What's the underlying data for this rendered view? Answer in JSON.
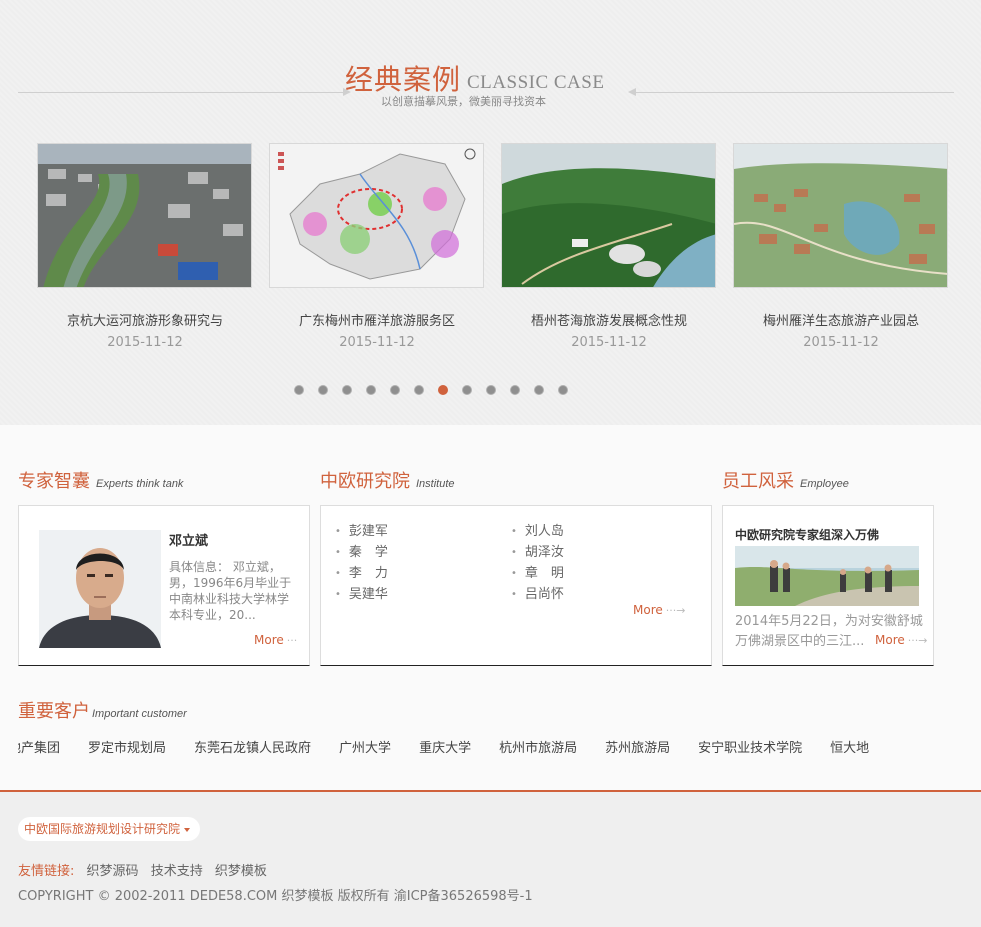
{
  "cases": {
    "title_cn": "经典案例",
    "title_en": "CLASSIC CASE",
    "subtitle": "以创意描摹风景，微美丽寻找资本",
    "items": [
      {
        "name": "京杭大运河旅游形象研究与",
        "date": "2015-11-12",
        "image": "city-canal-aerial"
      },
      {
        "name": "广东梅州市雁洋旅游服务区",
        "date": "2015-11-12",
        "image": "planning-map"
      },
      {
        "name": "梧州苍海旅游发展概念性规",
        "date": "2015-11-12",
        "image": "green-park-rendering"
      },
      {
        "name": "梅州雁洋生态旅游产业园总",
        "date": "2015-11-12",
        "image": "eco-park-rendering"
      }
    ],
    "pager": {
      "count": 12,
      "active_index": 6
    }
  },
  "experts": {
    "title": "专家智囊",
    "title_en": "Experts think tank",
    "name": "邓立斌",
    "info": "具体信息： 邓立斌，男，1996年6月毕业于中南林业科技大学林学本科专业，20...",
    "more": "More",
    "more_arrow": "···"
  },
  "institute": {
    "title": "中欧研究院",
    "title_en": "Institute",
    "col1": [
      "彭建军",
      "秦　学",
      "李　力",
      "吴建华"
    ],
    "col2": [
      "刘人岛",
      "胡泽汝",
      "章　明",
      "吕尚怀"
    ],
    "more": "More",
    "more_arrow": "···→"
  },
  "employee": {
    "title": "员工风采",
    "title_en": "Employee",
    "news_title": "中欧研究院专家组深入万佛",
    "desc": "2014年5月22日，为对安徽舒城万佛湖景区中的三江...",
    "more": "More",
    "more_arrow": "···→"
  },
  "customers": {
    "title": "重要客户",
    "title_en": "Important customer",
    "items": [
      "地产集团",
      "罗定市规划局",
      "东莞石龙镇人民政府",
      "广州大学",
      "重庆大学",
      "杭州市旅游局",
      "苏州旅游局",
      "安宁职业技术学院",
      "恒大地"
    ]
  },
  "footer": {
    "select_label": "中欧国际旅游规划设计研究院",
    "links_label": "友情链接:",
    "links": [
      "织梦源码",
      "技术支持",
      "织梦模板"
    ],
    "copyright": "COPYRIGHT © 2002-2011 DEDE58.COM 织梦模板 版权所有 渝ICP备36526598号-1"
  },
  "colors": {
    "accent": "#d0623d",
    "footer_bar": "#d0623d"
  }
}
